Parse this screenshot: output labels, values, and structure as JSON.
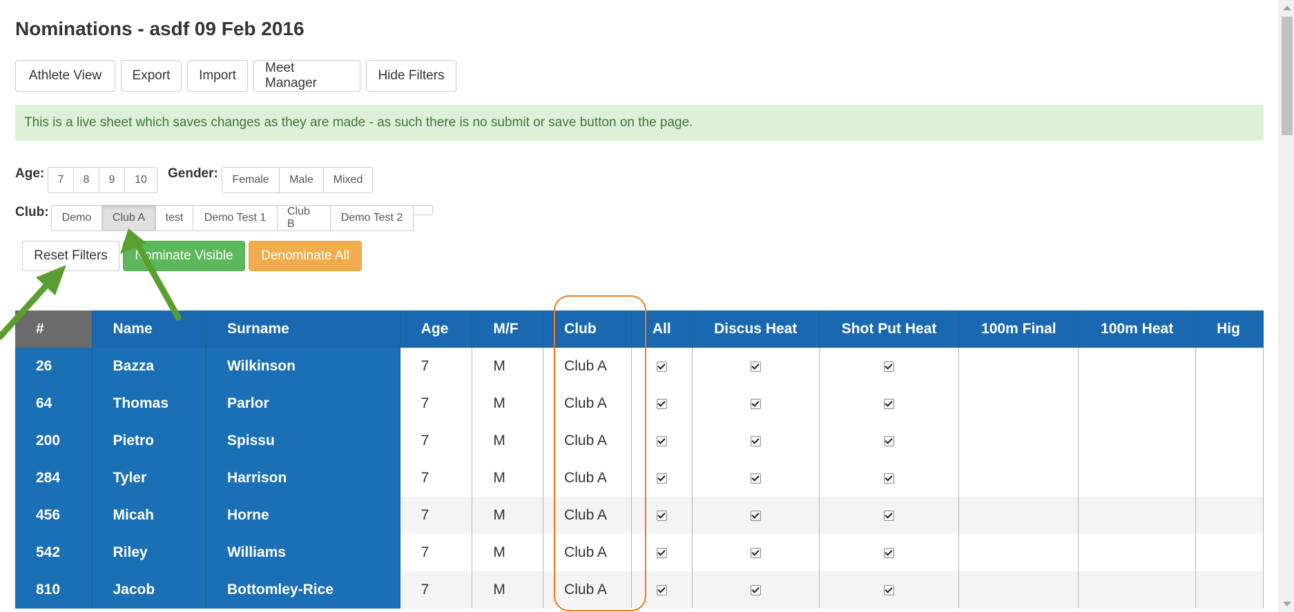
{
  "page": {
    "title": "Nominations - asdf 09 Feb 2016"
  },
  "toolbar": {
    "buttons": [
      "Athlete View",
      "Export",
      "Import",
      "Meet Manager",
      "Hide Filters"
    ]
  },
  "alert": {
    "text": "This is a live sheet which saves changes as they are made - as such there is no submit or save button on the page."
  },
  "filters": {
    "age_label": "Age:",
    "ages": [
      "7",
      "8",
      "9",
      "10"
    ],
    "gender_label": "Gender:",
    "genders": [
      "Female",
      "Male",
      "Mixed"
    ],
    "club_label": "Club:",
    "clubs": [
      "Demo",
      "Club A",
      "test",
      "Demo Test 1",
      "Club B",
      "Demo Test 2"
    ],
    "selected_club": "Club A"
  },
  "actions": {
    "reset": "Reset Filters",
    "nominate": "Nominate Visible",
    "denominate": "Denominate All"
  },
  "table": {
    "headers": {
      "hash": "#",
      "name": "Name",
      "surname": "Surname",
      "age": "Age",
      "mf": "M/F",
      "club": "Club",
      "all": "All",
      "discus": "Discus Heat",
      "shot": "Shot Put Heat",
      "final100": "100m Final",
      "heat100": "100m Heat",
      "high": "Hig"
    },
    "rows": [
      {
        "id": "26",
        "name": "Bazza",
        "surname": "Wilkinson",
        "age": "7",
        "mf": "M",
        "club": "Club A"
      },
      {
        "id": "64",
        "name": "Thomas",
        "surname": "Parlor",
        "age": "7",
        "mf": "M",
        "club": "Club A"
      },
      {
        "id": "200",
        "name": "Pietro",
        "surname": "Spissu",
        "age": "7",
        "mf": "M",
        "club": "Club A"
      },
      {
        "id": "284",
        "name": "Tyler",
        "surname": "Harrison",
        "age": "7",
        "mf": "M",
        "club": "Club A"
      },
      {
        "id": "456",
        "name": "Micah",
        "surname": "Horne",
        "age": "7",
        "mf": "M",
        "club": "Club A"
      },
      {
        "id": "542",
        "name": "Riley",
        "surname": "Williams",
        "age": "7",
        "mf": "M",
        "club": "Club A"
      },
      {
        "id": "810",
        "name": "Jacob",
        "surname": "Bottomley-Rice",
        "age": "7",
        "mf": "M",
        "club": "Club A"
      }
    ]
  },
  "annotations": {
    "arrow_color": "#5a9e2f",
    "highlight_color": "#ec7a1c"
  }
}
